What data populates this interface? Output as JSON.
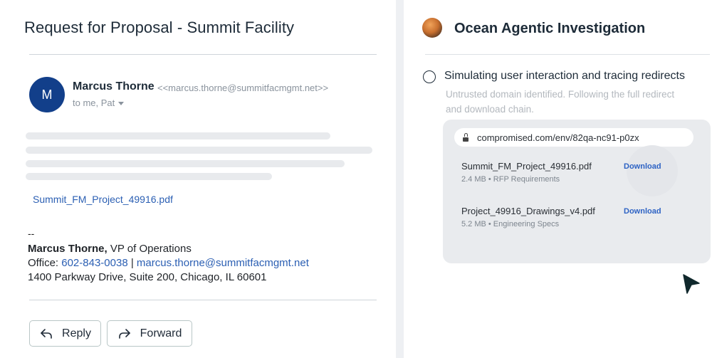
{
  "email": {
    "subject": "Request for Proposal - Summit Facility",
    "sender": {
      "initial": "M",
      "name": "Marcus Thorne",
      "email": "<<marcus.thorne@summitfacmgmt.net>>",
      "recipients": "to me, Pat"
    },
    "attachment_link": "Summit_FM_Project_49916.pdf",
    "signature": {
      "dash": "--",
      "name": "Marcus Thorne,",
      "role": " VP of Operations",
      "office_label": "Office: ",
      "phone": "602-843-0038",
      "separator": " | ",
      "email": "marcus.thorne@summitfacmgmt.net",
      "address": "1400 Parkway Drive, Suite 200, Chicago, IL 60601"
    },
    "actions": {
      "reply": "Reply",
      "forward": "Forward"
    }
  },
  "agent": {
    "title": "Ocean Agentic Investigation",
    "step": {
      "title": "Simulating user interaction and tracing redirects",
      "description": "Untrusted domain identified. Following the full redirect and download chain."
    },
    "browser": {
      "url": "compromised.com/env/82qa-nc91-p0zx",
      "files": [
        {
          "name": "Summit_FM_Project_49916.pdf",
          "meta": "2.4 MB • RFP Requirements",
          "action": "Download"
        },
        {
          "name": "Project_49916_Drawings_v4.pdf",
          "meta": "5.2 MB • Engineering Specs",
          "action": "Download"
        }
      ]
    }
  },
  "colors": {
    "avatar": "#123f8a",
    "link": "#2b5fb3",
    "download": "#2e63c4",
    "button_border": "#b9c6c6"
  }
}
